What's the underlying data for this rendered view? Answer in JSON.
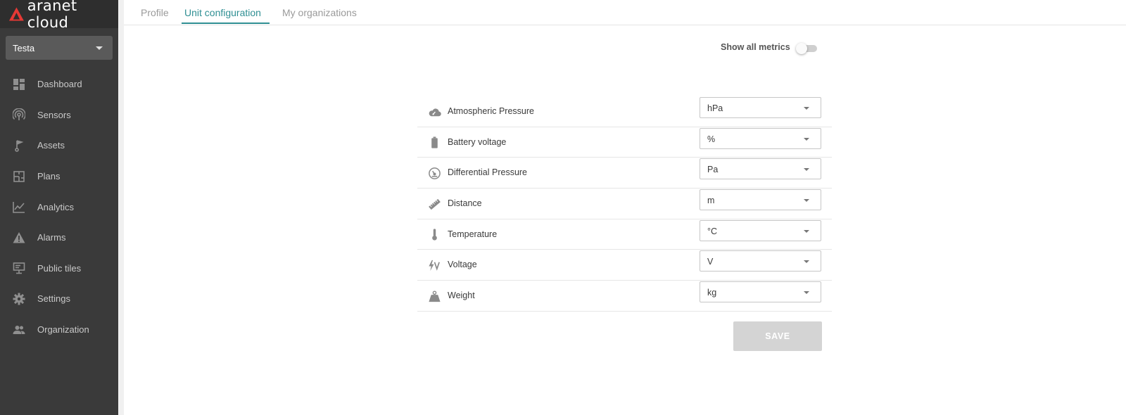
{
  "app": {
    "logo_text": "aranet cloud",
    "brand_color": "#e53935"
  },
  "sidebar": {
    "organization": "Testa",
    "items": [
      {
        "label": "Dashboard",
        "icon": "dashboard-icon"
      },
      {
        "label": "Sensors",
        "icon": "sensors-icon"
      },
      {
        "label": "Assets",
        "icon": "assets-icon"
      },
      {
        "label": "Plans",
        "icon": "plans-icon"
      },
      {
        "label": "Analytics",
        "icon": "analytics-icon"
      },
      {
        "label": "Alarms",
        "icon": "alarm-warning-icon"
      },
      {
        "label": "Public tiles",
        "icon": "public-tiles-icon"
      },
      {
        "label": "Settings",
        "icon": "gear-icon"
      },
      {
        "label": "Organization",
        "icon": "people-icon"
      }
    ]
  },
  "tabs": {
    "items": [
      {
        "label": "Profile"
      },
      {
        "label": "Unit configuration"
      },
      {
        "label": "My organizations"
      }
    ],
    "active": "Unit configuration",
    "accent_color": "#2f8f93"
  },
  "toggle": {
    "label": "Show all metrics",
    "checked": false
  },
  "metrics": [
    {
      "name": "Atmospheric Pressure",
      "unit": "hPa",
      "icon": "cloud-gauge-icon"
    },
    {
      "name": "Battery voltage",
      "unit": "%",
      "icon": "battery-icon"
    },
    {
      "name": "Differential Pressure",
      "unit": "Pa",
      "icon": "gauge-icon"
    },
    {
      "name": "Distance",
      "unit": "m",
      "icon": "ruler-icon"
    },
    {
      "name": "Temperature",
      "unit": "°C",
      "icon": "thermometer-icon"
    },
    {
      "name": "Voltage",
      "unit": "V",
      "icon": "voltage-icon"
    },
    {
      "name": "Weight",
      "unit": "kg",
      "icon": "weight-icon"
    }
  ],
  "actions": {
    "save_label": "SAVE",
    "save_disabled": true
  }
}
